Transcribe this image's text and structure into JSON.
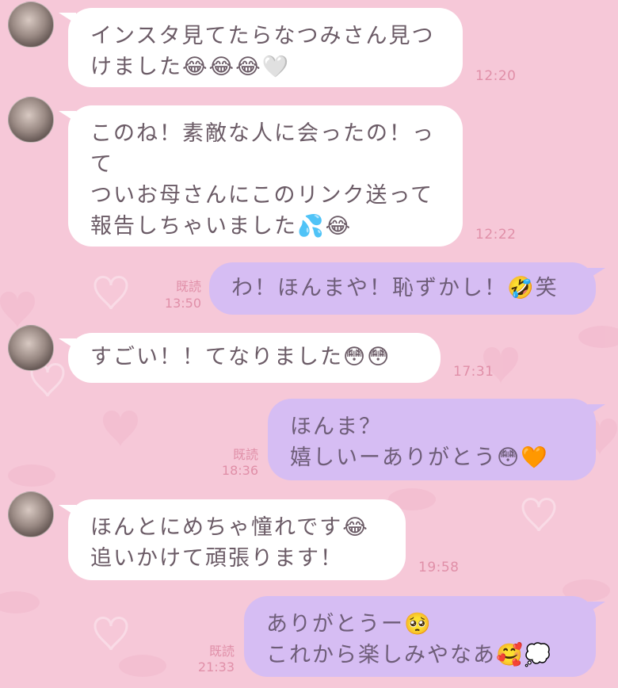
{
  "colors": {
    "background": "#f6c8d8",
    "incoming_bubble": "#ffffff",
    "outgoing_bubble": "#d6bdf3",
    "timestamp": "#e08fa8"
  },
  "messages": [
    {
      "side": "in",
      "text": "インスタ見てたらなつみさん見つ\nけました😂😂😂🤍",
      "time": "12:20"
    },
    {
      "side": "in",
      "text": "このね！素敵な人に会ったの！っ\nて\nついお母さんにこのリンク送って\n報告しちゃいました💦😂",
      "time": "12:22"
    },
    {
      "side": "out",
      "text": "わ！ほんまや！恥ずかし！🤣笑",
      "read": "既読",
      "time": "13:50"
    },
    {
      "side": "in",
      "text": "すごい！！てなりました😳😳",
      "time": "17:31"
    },
    {
      "side": "out",
      "text": "ほんま？\n嬉しいーありがとう😳🧡",
      "read": "既読",
      "time": "18:36"
    },
    {
      "side": "in",
      "text": "ほんとにめちゃ憧れです😂\n追いかけて頑張ります！",
      "time": "19:58"
    },
    {
      "side": "out",
      "text": "ありがとうー🥺\nこれから楽しみやなあ🥰💭",
      "read": "既読",
      "time": "21:33"
    }
  ]
}
